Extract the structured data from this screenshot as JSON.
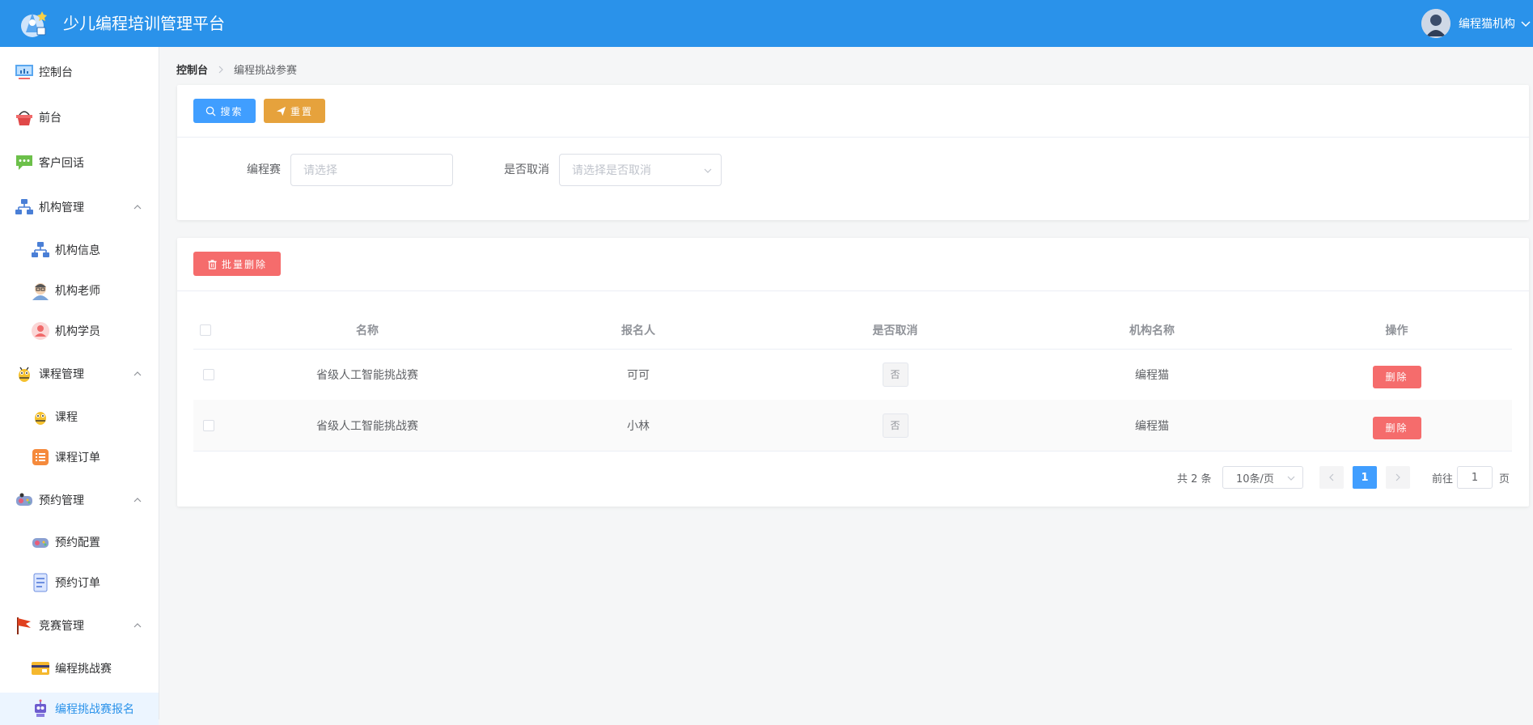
{
  "header": {
    "title": "少儿编程培训管理平台",
    "user_name": "编程猫机构"
  },
  "sidebar": {
    "items": [
      {
        "label": "控制台",
        "icon": "monitor-icon"
      },
      {
        "label": "前台",
        "icon": "basket-icon"
      },
      {
        "label": "客户回话",
        "icon": "chat-bubble-icon"
      },
      {
        "label": "机构管理",
        "icon": "org-chart-icon"
      },
      {
        "label": "机构信息",
        "icon": "org-chart-icon"
      },
      {
        "label": "机构老师",
        "icon": "teacher-avatar-icon"
      },
      {
        "label": "机构学员",
        "icon": "student-avatar-icon"
      },
      {
        "label": "课程管理",
        "icon": "bee-icon"
      },
      {
        "label": "课程",
        "icon": "bee-icon"
      },
      {
        "label": "课程订单",
        "icon": "order-list-icon"
      },
      {
        "label": "预约管理",
        "icon": "gamepad-icon"
      },
      {
        "label": "预约配置",
        "icon": "gamepad-icon"
      },
      {
        "label": "预约订单",
        "icon": "document-icon"
      },
      {
        "label": "竞赛管理",
        "icon": "flag-icon"
      },
      {
        "label": "编程挑战赛",
        "icon": "ticket-icon"
      },
      {
        "label": "编程挑战赛报名",
        "icon": "robot-icon"
      }
    ]
  },
  "breadcrumb": {
    "home": "控制台",
    "current": "编程挑战参赛"
  },
  "search": {
    "search_label": "搜索",
    "reset_label": "重置",
    "field1_label": "编程赛",
    "field1_placeholder": "请选择",
    "field2_label": "是否取消",
    "field2_placeholder": "请选择是否取消"
  },
  "toolbar": {
    "batch_delete_label": "批量删除"
  },
  "table": {
    "columns": [
      "名称",
      "报名人",
      "是否取消",
      "机构名称",
      "操作"
    ],
    "rows": [
      {
        "name": "省级人工智能挑战赛",
        "applicant": "可可",
        "cancelled": "否",
        "org": "编程猫",
        "action": "删除"
      },
      {
        "name": "省级人工智能挑战赛",
        "applicant": "小林",
        "cancelled": "否",
        "org": "编程猫",
        "action": "删除"
      }
    ]
  },
  "pagination": {
    "total_text": "共 2 条",
    "page_size": "10条/页",
    "current_page": "1",
    "goto_prefix": "前往",
    "goto_value": "1",
    "goto_suffix": "页"
  },
  "colors": {
    "header_bg": "#2a92ea",
    "primary": "#409eff",
    "warning": "#e6a23c",
    "danger": "#f56c6c",
    "active_menu_bg": "#ecf5ff"
  }
}
